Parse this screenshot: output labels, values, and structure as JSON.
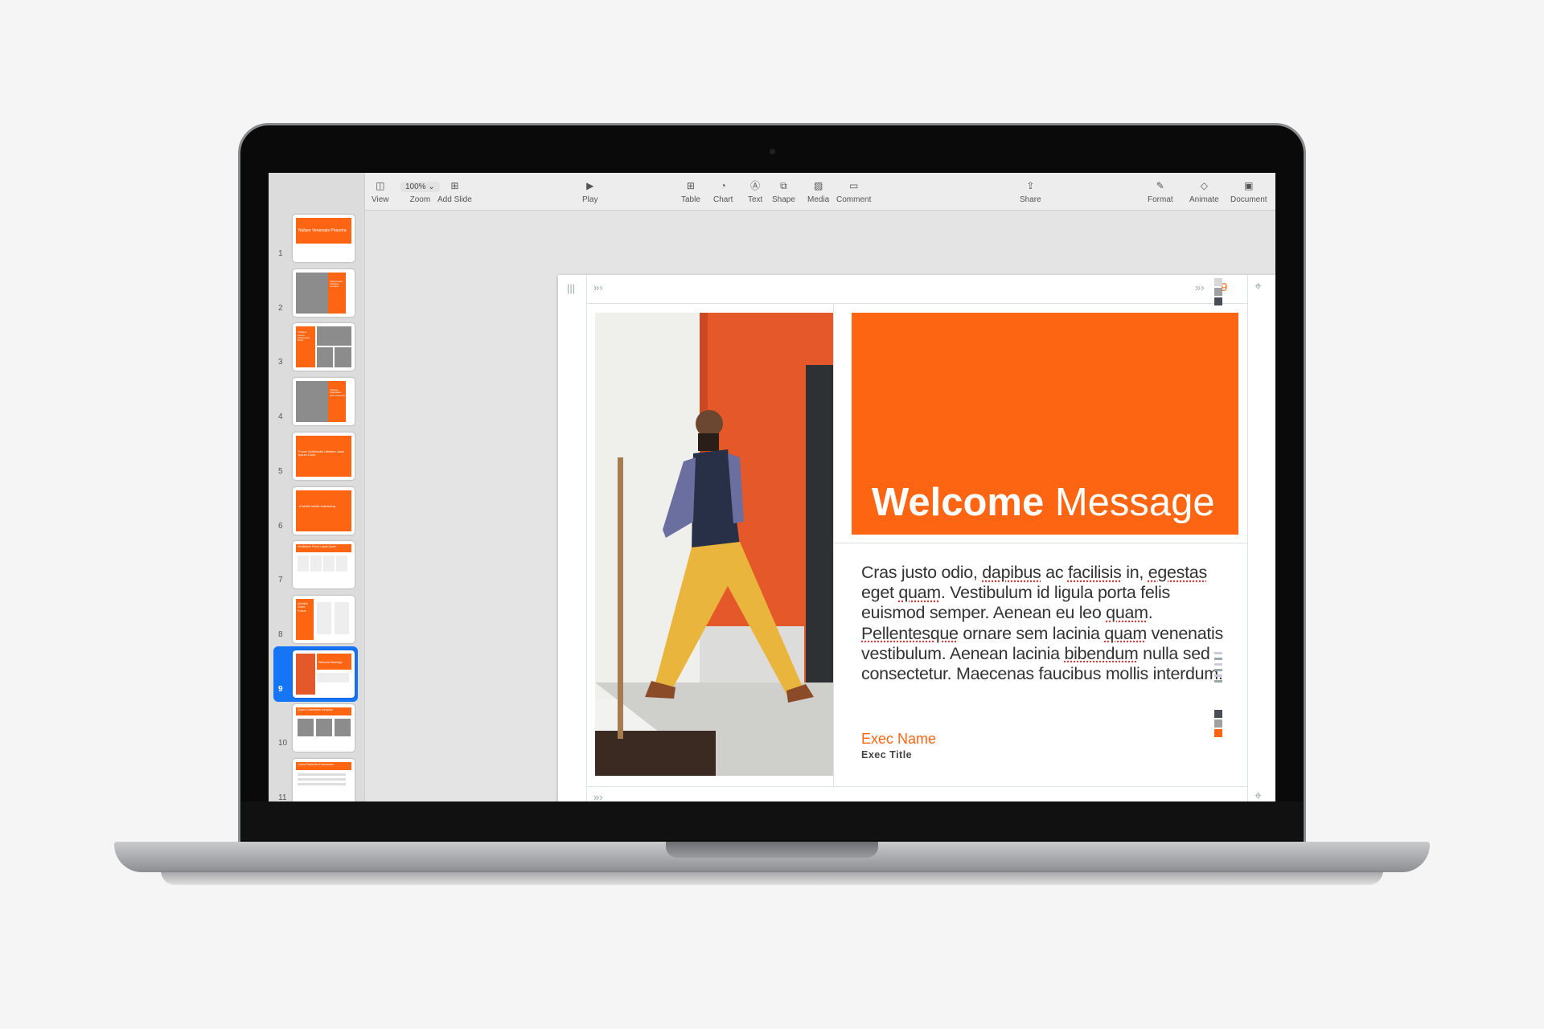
{
  "toolbar": {
    "view": "View",
    "zoom_value": "100%",
    "zoom": "Zoom",
    "add_slide": "Add Slide",
    "play": "Play",
    "table": "Table",
    "chart": "Chart",
    "text": "Text",
    "shape": "Shape",
    "media": "Media",
    "comment": "Comment",
    "share": "Share",
    "format": "Format",
    "animate": "Animate",
    "document": "Document"
  },
  "navigator": {
    "selected": 9,
    "slides": [
      {
        "num": "1",
        "layout": "title",
        "title": "Nullam Venenatis Pharetra"
      },
      {
        "num": "2",
        "layout": "photo-text",
        "title": "Ullamcorper Tristique Consect"
      },
      {
        "num": "3",
        "layout": "text-photos",
        "title": "Tristique Lorem Malesuada Dolor"
      },
      {
        "num": "4",
        "layout": "photo-text",
        "title": "Ultricies Sollicitudin Sem Pharetra"
      },
      {
        "num": "5",
        "layout": "full",
        "title": "Fusce Sollicitudin Ultricies Justo Ipsum Dolor"
      },
      {
        "num": "6",
        "layout": "full",
        "title": "-8 Mollis Mattis Adipiscing"
      },
      {
        "num": "7",
        "layout": "columns",
        "title": "Vestibulum Purus Ligula Quam"
      },
      {
        "num": "8",
        "layout": "side-list",
        "title": "Vestibu Dolor Fusce"
      },
      {
        "num": "9",
        "layout": "welcome",
        "title": "Welcome Message"
      },
      {
        "num": "10",
        "layout": "three-photos",
        "title": "Quam Consectetur Inceptos"
      },
      {
        "num": "11",
        "layout": "bullets",
        "title": "Lorem Parturient Fermentum"
      }
    ]
  },
  "slide": {
    "number": "9",
    "title_bold": "Welcome",
    "title_light": "Message",
    "body": [
      {
        "t": "Cras justo odio, "
      },
      {
        "t": "dapibus",
        "sq": true
      },
      {
        "t": " ac "
      },
      {
        "t": "facilisis",
        "sq": true
      },
      {
        "t": " in, "
      },
      {
        "t": "egestas",
        "sq": true
      },
      {
        "t": " eget "
      },
      {
        "t": "quam",
        "sq": true
      },
      {
        "t": ". Vestibulum id ligula porta felis euismod semper. Aenean eu leo "
      },
      {
        "t": "quam",
        "sq": true
      },
      {
        "t": ". "
      },
      {
        "t": "Pellentesque",
        "sq": true
      },
      {
        "t": " ornare sem lacinia "
      },
      {
        "t": "quam",
        "sq": true
      },
      {
        "t": " venenatis vestibulum. Aenean lacinia "
      },
      {
        "t": "bibendum",
        "sq": true
      },
      {
        "t": " nulla sed consectetur. Maecenas faucibus mollis interdum."
      }
    ],
    "exec_name": "Exec Name",
    "exec_title": "Exec Title"
  },
  "colors": {
    "accent": "#fe6512",
    "selection": "#1675f5",
    "swatches_top": [
      "#d8d8d8",
      "#a0a0a0",
      "#4a4d55"
    ],
    "swatches_bottom": [
      "#4a4d55",
      "#a0a0a0",
      "#fe6512"
    ]
  }
}
